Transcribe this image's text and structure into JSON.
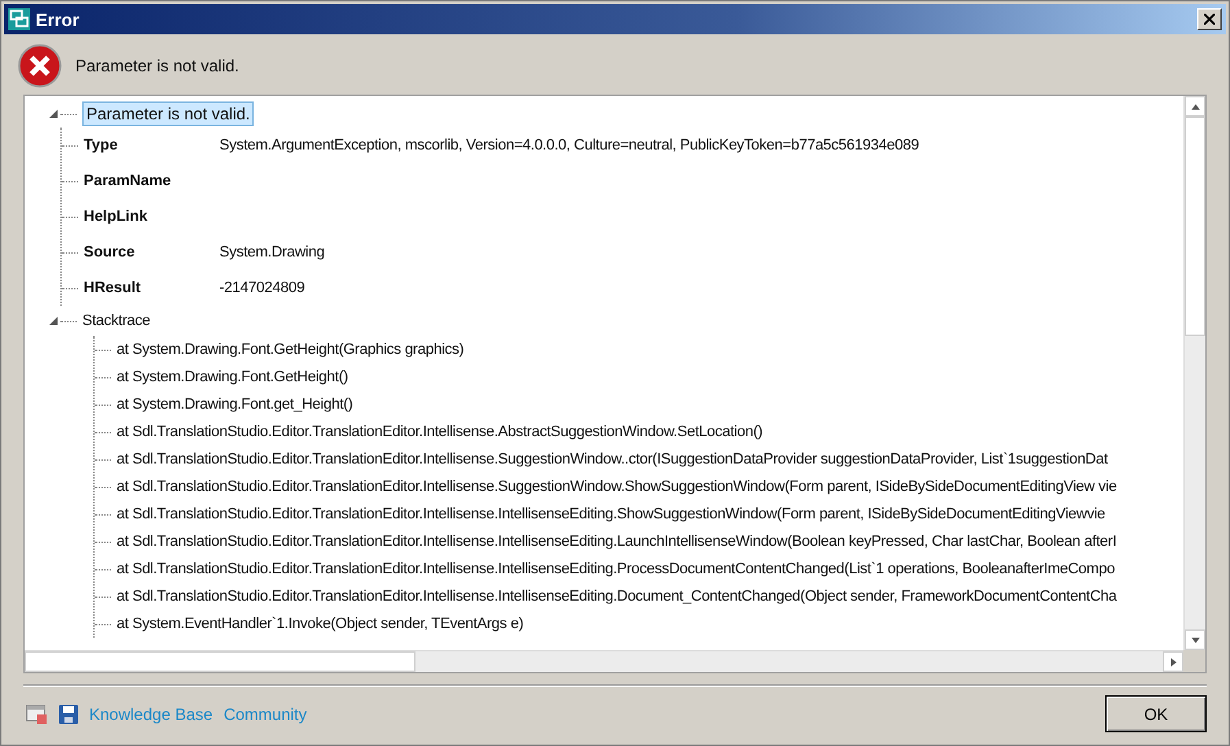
{
  "window": {
    "title": "Error"
  },
  "message": "Parameter is not valid.",
  "tree": {
    "label": "Parameter is not valid.",
    "expanded": true,
    "selected": true,
    "properties": [
      {
        "name": "Type",
        "value": "System.ArgumentException, mscorlib, Version=4.0.0.0, Culture=neutral, PublicKeyToken=b77a5c561934e089"
      },
      {
        "name": "ParamName"
      },
      {
        "name": "HelpLink"
      },
      {
        "name": "Source",
        "value": "System.Drawing"
      },
      {
        "name": "HResult",
        "value": "-2147024809"
      }
    ],
    "stacktrace": {
      "label": "Stacktrace",
      "expanded": true,
      "frames": [
        "at System.Drawing.Font.GetHeight(Graphics graphics)",
        "at System.Drawing.Font.GetHeight()",
        "at System.Drawing.Font.get_Height()",
        "at Sdl.TranslationStudio.Editor.TranslationEditor.Intellisense.AbstractSuggestionWindow.SetLocation()",
        "at Sdl.TranslationStudio.Editor.TranslationEditor.Intellisense.SuggestionWindow..ctor(ISuggestionDataProvider suggestionDataProvider, List`1suggestionDat",
        "at Sdl.TranslationStudio.Editor.TranslationEditor.Intellisense.SuggestionWindow.ShowSuggestionWindow(Form parent, ISideBySideDocumentEditingView vie",
        "at Sdl.TranslationStudio.Editor.TranslationEditor.Intellisense.IntellisenseEditing.ShowSuggestionWindow(Form parent, ISideBySideDocumentEditingViewvie",
        "at Sdl.TranslationStudio.Editor.TranslationEditor.Intellisense.IntellisenseEditing.LaunchIntellisenseWindow(Boolean keyPressed, Char lastChar, Boolean afterI",
        "at Sdl.TranslationStudio.Editor.TranslationEditor.Intellisense.IntellisenseEditing.ProcessDocumentContentChanged(List`1 operations, BooleanafterImeCompo",
        "at Sdl.TranslationStudio.Editor.TranslationEditor.Intellisense.IntellisenseEditing.Document_ContentChanged(Object sender, FrameworkDocumentContentCha",
        "at System.EventHandler`1.Invoke(Object sender, TEventArgs e)"
      ]
    }
  },
  "footer": {
    "links": [
      "Knowledge Base",
      "Community"
    ],
    "ok": "OK"
  }
}
